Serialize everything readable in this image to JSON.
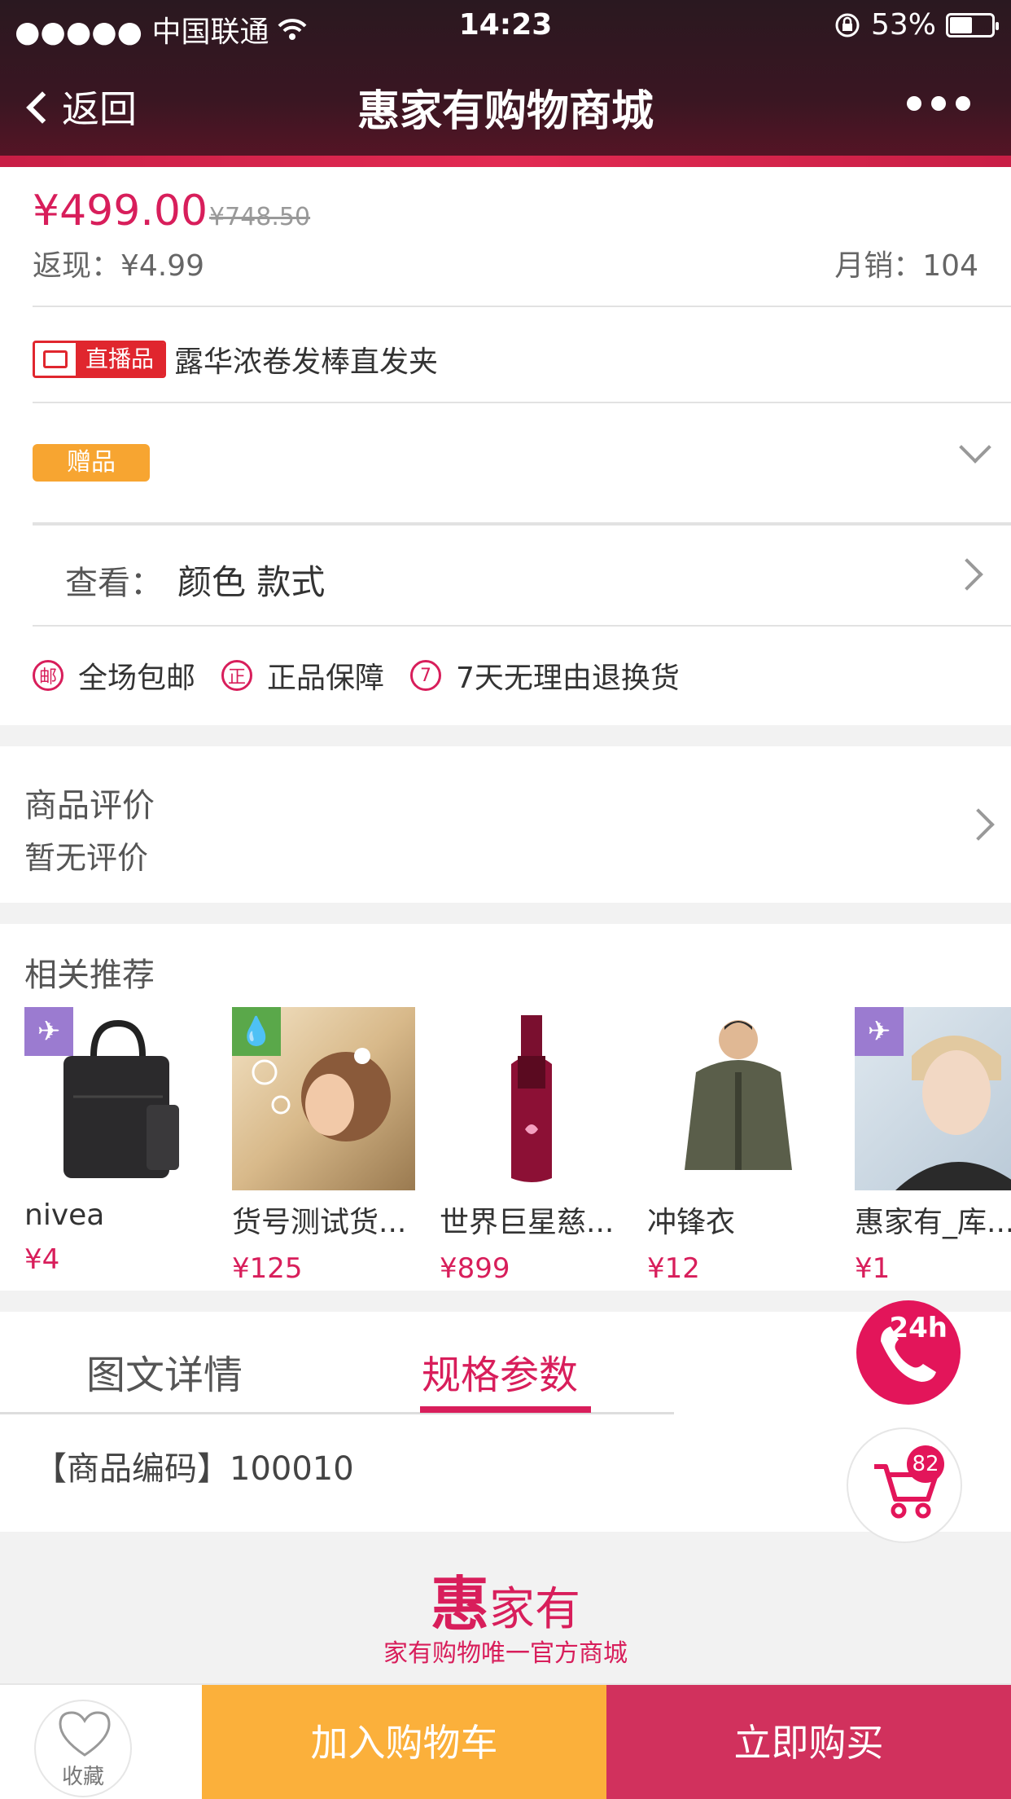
{
  "status_bar": {
    "carrier": "●●●●● 中国联通",
    "time": "14:23",
    "battery": "53%"
  },
  "nav": {
    "back_label": "返回",
    "title": "惠家有购物商城"
  },
  "product": {
    "price": "¥499.00",
    "original_price": "¥748.50",
    "cashback": "返现：¥4.99",
    "sales": "月销：104",
    "live_badge": "直播品",
    "name": "露华浓卷发棒直发夹",
    "gift_badge": "赠品",
    "view_label": "查看：",
    "view_options": "颜色 款式"
  },
  "features": [
    {
      "icon": "邮",
      "label": "全场包邮"
    },
    {
      "icon": "正",
      "label": "正品保障"
    },
    {
      "icon": "7",
      "label": "7天无理由退换货"
    }
  ],
  "reviews": {
    "title": "商品评价",
    "subtitle": "暂无评价"
  },
  "recommend": {
    "title": "相关推荐",
    "items": [
      {
        "name": "nivea",
        "price": "¥4",
        "badge": "plane-icon"
      },
      {
        "name": "货号测试货...",
        "price": "¥125",
        "badge": "drop-icon"
      },
      {
        "name": "世界巨星慈...",
        "price": "¥899",
        "badge": ""
      },
      {
        "name": "冲锋衣",
        "price": "¥12",
        "badge": ""
      },
      {
        "name": "惠家有_库...",
        "price": "¥1",
        "badge": "plane-icon"
      }
    ]
  },
  "tabs": {
    "details": "图文详情",
    "specs": "规格参数"
  },
  "spec": {
    "code": "【商品编码】100010"
  },
  "brand": {
    "logo_hui": "惠",
    "logo_rest": "家有",
    "slogan": "家有购物唯一官方商城"
  },
  "floating": {
    "phone_label": "24h",
    "cart_count": "82"
  },
  "bottom": {
    "fav_label": "收藏",
    "add_cart": "加入购物车",
    "buy_now": "立即购买"
  },
  "colors": {
    "accent": "#d81e5b",
    "cart_button": "#fbb03b",
    "buy_button": "#d1315d",
    "nav_bg": "#3a1622"
  }
}
